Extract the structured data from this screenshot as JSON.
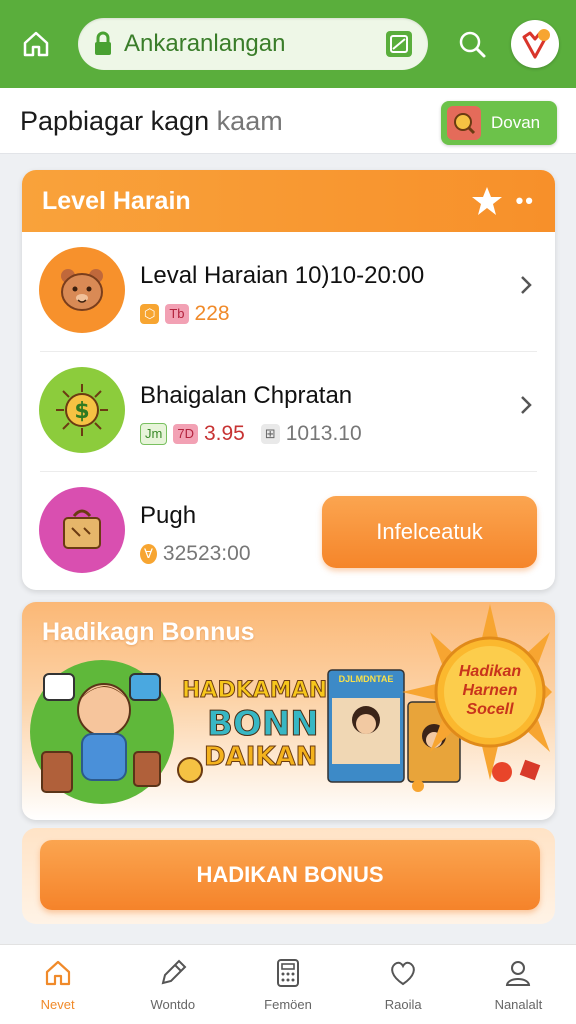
{
  "topbar": {
    "url": "Ankaranlangan"
  },
  "subheader": {
    "title_main": "Papbiagar kagn",
    "title_muted": "kaam",
    "action_label": "Dovan"
  },
  "card": {
    "title": "Level  Harain",
    "more": "••",
    "rows": [
      {
        "title": "Leval Haraian 10)10-20:00",
        "tag1": "⬡",
        "tag2": "Tb",
        "value": "228"
      },
      {
        "title": "Bhaigalan Chpratan",
        "tag1": "Jm",
        "tag2": "7D",
        "value": "3.95",
        "tag3": "⊞",
        "value2": "1013.10"
      },
      {
        "title": "Pugh",
        "tag1": "∀",
        "value": "32523:00",
        "cta": "Infelceatuk"
      }
    ]
  },
  "banner": {
    "title": "Hadikagn Bonnus",
    "word1": "HADKAMAN",
    "word2": "BONN",
    "word3": "DAIKAN",
    "poster_label": "DJLMDNTAE",
    "sun_text": "Hadikan Harnen Socell"
  },
  "big_button": {
    "label": "HADIKAN BONUS"
  },
  "bottomnav": {
    "items": [
      {
        "label": "Nevet",
        "icon": "home-icon",
        "active": true
      },
      {
        "label": "Wontdo",
        "icon": "edit-icon",
        "active": false
      },
      {
        "label": "Femöen",
        "icon": "calculator-icon",
        "active": false
      },
      {
        "label": "Raoila",
        "icon": "heart-icon",
        "active": false
      },
      {
        "label": "Nanalalt",
        "icon": "user-icon",
        "active": false
      }
    ]
  },
  "colors": {
    "brand_green": "#5aae3c",
    "accent_orange": "#f7902a"
  }
}
